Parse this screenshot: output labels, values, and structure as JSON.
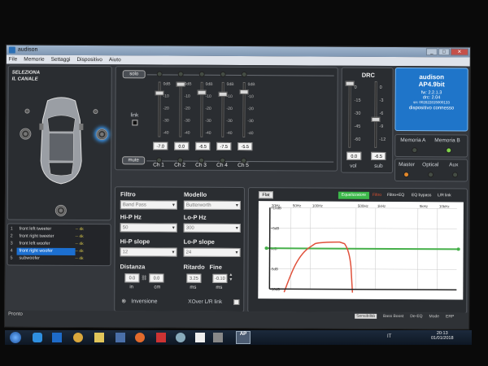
{
  "window": {
    "title": "audison",
    "buttons": [
      "_",
      "□",
      "✕"
    ]
  },
  "menu": [
    "File",
    "Memorie",
    "Settaggi",
    "Dispositivo",
    "Aiuto"
  ],
  "left": {
    "title_line1": "SELEZIONA",
    "title_line2": "IL CANALE"
  },
  "channels": [
    {
      "num": "1",
      "name": "front left tweeter",
      "level": "--  4k"
    },
    {
      "num": "2",
      "name": "front right tweeter",
      "level": "--  4k"
    },
    {
      "num": "3",
      "name": "front left woofer",
      "level": "--  4k"
    },
    {
      "num": "4",
      "name": "front right woofer",
      "level": "--  4k"
    },
    {
      "num": "5 ",
      "name": "subwoofer",
      "level": "--  4k"
    }
  ],
  "mixer": {
    "solo_label": "solo",
    "mute_label": "mute",
    "link_label": "link",
    "scale": [
      "0dB",
      "-10",
      "-20",
      "-30",
      "-40"
    ],
    "faders": [
      {
        "label": "Ch 1",
        "value": "-7.0",
        "level": 0.18
      },
      {
        "label": "Ch 2",
        "value": "0.0",
        "level": 0.0
      },
      {
        "label": "Ch 3",
        "value": "-6.5",
        "level": 0.16
      },
      {
        "label": "Ch 4",
        "value": "-7.5",
        "level": 0.19
      },
      {
        "label": "Ch 5",
        "value": "-5.5",
        "level": 0.14
      }
    ]
  },
  "drc": {
    "title": "DRC",
    "vol_scale": [
      "0",
      "-15",
      "-30",
      "-45",
      "-60"
    ],
    "sub_scale": [
      "0",
      "-3",
      "-6",
      "-9",
      "-12"
    ],
    "vol_value": "0.0",
    "sub_value": "-6.5",
    "vol_label": "vol",
    "sub_label": "sub"
  },
  "device": {
    "brand": "audison",
    "model": "AP4.9bit",
    "fw": "fw: 2.2.1.3",
    "drc": "drc: 2.04",
    "sn": "sn: 002822815000133",
    "status": "dispositivo connesso"
  },
  "memory": {
    "a": "Memoria A",
    "b": "Memoria B"
  },
  "inputs": {
    "master": "Master",
    "optical": "Optical",
    "aux": "Aux"
  },
  "filter": {
    "filtro_label": "Filtro",
    "filtro_value": "Band Pass",
    "modello_label": "Modello",
    "modello_value": "Butterworth",
    "hip_hz_label": "Hi-P Hz",
    "hip_hz_value": "50",
    "lop_hz_label": "Lo-P Hz",
    "lop_hz_value": "300",
    "hip_slope_label": "Hi-P slope",
    "hip_slope_value": "12",
    "lop_slope_label": "Lo-P slope",
    "lop_slope_value": "24",
    "distanza_label": "Distanza",
    "dist_in": "0.0",
    "dist_cm": "0.0",
    "in_unit": "in",
    "cm_unit": "cm",
    "ritardo_label": "Ritardo",
    "fine_label": "Fine",
    "ritardo_value": "3.25",
    "fine_value": "-0.10",
    "ms_unit": "ms",
    "inversione": "Inversione",
    "xover_link": "XOver L/R link"
  },
  "eq": {
    "flat_btn": "Flat",
    "equalizzatore": "Equalizzatore",
    "filtro_eq": "Filtro+EQ",
    "eq_bypass": "EQ bypass",
    "lr_link": "L/R link",
    "x_labels": [
      "20Hz",
      "50Hz",
      "100Hz",
      "500Hz",
      "1kHz",
      "5kHz",
      "10kHz"
    ],
    "y_labels": [
      "+10dB",
      "+5dB",
      "0dB",
      "-5dB",
      "-10dB"
    ]
  },
  "status": {
    "left": "Pronto",
    "items": [
      "Sensibilità",
      "Bass Boost",
      "De-EQ",
      "Mode",
      "ERP"
    ]
  },
  "taskbar": {
    "time": "20:13",
    "date": "01/01/2018",
    "lang": "IT"
  }
}
